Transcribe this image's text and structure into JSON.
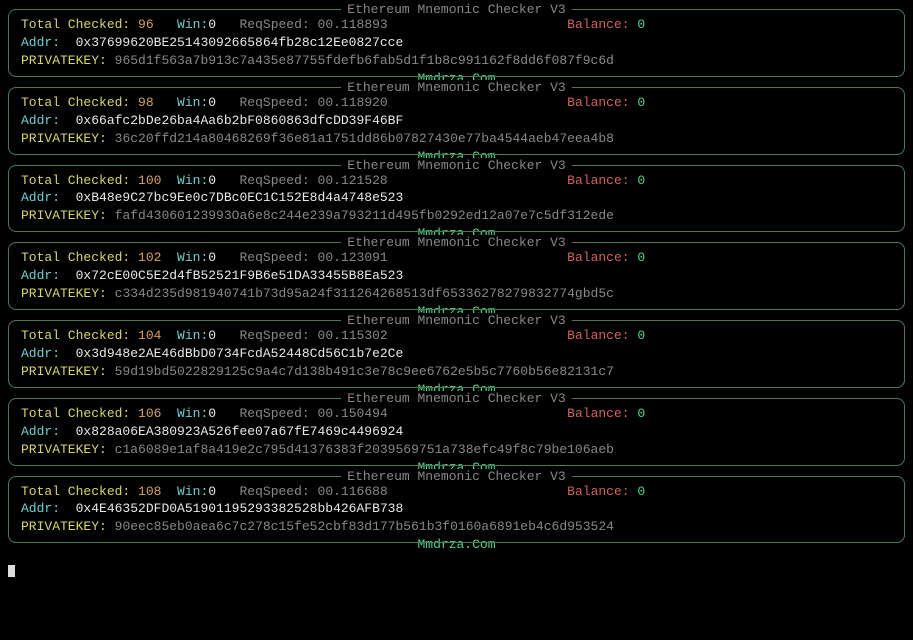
{
  "labels": {
    "block_title": "Ethereum Mnemonic Checker V3",
    "footer": "Mmdrza.Com",
    "total_checked": "Total Checked:",
    "win": "Win:",
    "reqspeed": "ReqSpeed:",
    "balance": "Balance:",
    "addr": "Addr:",
    "privatekey": "PRIVATEKEY:"
  },
  "blocks": [
    {
      "checked": "96",
      "win": "0",
      "reqspeed": "00.118893",
      "balance": "0",
      "addr": "0x37699620BE25143092665864fb28c12Ee0827cce",
      "pk": "965d1f563a7b913c7a435e87755fdefb6fab5d1f1b8c991162f8dd6f087f9c6d"
    },
    {
      "checked": "98",
      "win": "0",
      "reqspeed": "00.118920",
      "balance": "0",
      "addr": "0x66afc2bDe26ba4Aa6b2bF0860863dfcDD39F46BF",
      "pk": "36c20ffd214a80468269f36e81a1751dd86b07827430e77ba4544aeb47eea4b8"
    },
    {
      "checked": "100",
      "win": "0",
      "reqspeed": "00.121528",
      "balance": "0",
      "addr": "0xB48e9C27bc9Ee0c7DBc0EC1C152E8d4a4748e523",
      "pk": "fafd43060123993Oa6e8c244e239a793211d495fb0292ed12a07e7c5df312ede"
    },
    {
      "checked": "102",
      "win": "0",
      "reqspeed": "00.123091",
      "balance": "0",
      "addr": "0x72cE00C5E2d4fB52521F9B6e51DA33455B8Ea523",
      "pk": "c334d235d981940741b73d95a24f311264268513df65336278279832774gbd5c"
    },
    {
      "checked": "104",
      "win": "0",
      "reqspeed": "00.115302",
      "balance": "0",
      "addr": "0x3d948e2AE46dBbD0734FcdA52448Cd56C1b7e2Ce",
      "pk": "59d19bd5022829125c9a4c7d138b491c3e78c9ee6762e5b5c7760b56e82131c7"
    },
    {
      "checked": "106",
      "win": "0",
      "reqspeed": "00.150494",
      "balance": "0",
      "addr": "0x828a06EA380923A526fee07a67fE7469c4496924",
      "pk": "c1a6089e1af8a419e2c795d41376383f2039569751a738efc49f8c79be106aeb"
    },
    {
      "checked": "108",
      "win": "0",
      "reqspeed": "00.116688",
      "balance": "0",
      "addr": "0x4E46352DFD0A51901195293382528bb426AFB738",
      "pk": "90eec85eb0aea6c7c278c15fe52cbf83d177b561b3f0160a6891eb4c6d953524"
    }
  ]
}
